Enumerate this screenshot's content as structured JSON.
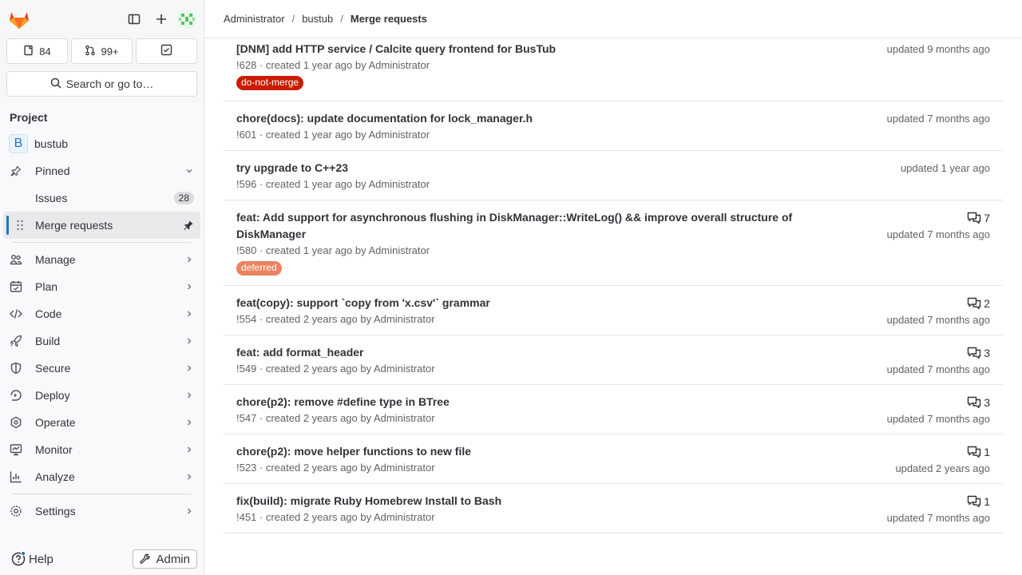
{
  "sidebar": {
    "counters": {
      "issues": "84",
      "merge_requests": "99+"
    },
    "search_label": "Search or go to…",
    "section_title": "Project",
    "project": {
      "initial": "B",
      "name": "bustub"
    },
    "pinned_label": "Pinned",
    "pinned_items": [
      {
        "label": "Issues",
        "count": "28"
      },
      {
        "label": "Merge requests"
      }
    ],
    "menu": [
      {
        "label": "Manage",
        "icon": "users-icon"
      },
      {
        "label": "Plan",
        "icon": "planning-icon"
      },
      {
        "label": "Code",
        "icon": "code-icon"
      },
      {
        "label": "Build",
        "icon": "rocket-icon"
      },
      {
        "label": "Secure",
        "icon": "shield-icon"
      },
      {
        "label": "Deploy",
        "icon": "deployments-icon"
      },
      {
        "label": "Operate",
        "icon": "cloud-gear-icon"
      },
      {
        "label": "Monitor",
        "icon": "monitor-icon"
      },
      {
        "label": "Analyze",
        "icon": "chart-icon"
      }
    ],
    "settings_label": "Settings",
    "help_label": "Help",
    "admin_label": "Admin"
  },
  "breadcrumb": [
    "Administrator",
    "bustub",
    "Merge requests"
  ],
  "merge_requests": [
    {
      "title": "[DNM] add HTTP service / Calcite query frontend for BusTub",
      "meta": "!628 · created 1 year ago by Administrator",
      "updated": "updated 9 months ago",
      "comments": "",
      "label": "do-not-merge",
      "label_color": "#c91c00"
    },
    {
      "title": "chore(docs): update documentation for lock_manager.h",
      "meta": "!601 · created 1 year ago by Administrator",
      "updated": "updated 7 months ago",
      "comments": "",
      "label": "",
      "label_color": ""
    },
    {
      "title": "try upgrade to C++23",
      "meta": "!596 · created 1 year ago by Administrator",
      "updated": "updated 1 year ago",
      "comments": "",
      "label": "",
      "label_color": ""
    },
    {
      "title": "feat: Add support for asynchronous flushing in DiskManager::WriteLog() && improve overall structure of DiskManager",
      "meta": "!580 · created 1 year ago by Administrator",
      "updated": "updated 7 months ago",
      "comments": "7",
      "label": "deferred",
      "label_color": "#e9845f"
    },
    {
      "title": "feat(copy): support `copy from 'x.csv'` grammar",
      "meta": "!554 · created 2 years ago by Administrator",
      "updated": "updated 7 months ago",
      "comments": "2",
      "label": "",
      "label_color": ""
    },
    {
      "title": "feat: add format_header",
      "meta": "!549 · created 2 years ago by Administrator",
      "updated": "updated 7 months ago",
      "comments": "3",
      "label": "",
      "label_color": ""
    },
    {
      "title": "chore(p2): remove #define type in BTree",
      "meta": "!547 · created 2 years ago by Administrator",
      "updated": "updated 7 months ago",
      "comments": "3",
      "label": "",
      "label_color": ""
    },
    {
      "title": "chore(p2): move helper functions to new file",
      "meta": "!523 · created 2 years ago by Administrator",
      "updated": "updated 2 years ago",
      "comments": "1",
      "label": "",
      "label_color": ""
    },
    {
      "title": "fix(build): migrate Ruby Homebrew Install to Bash",
      "meta": "!451 · created 2 years ago by Administrator",
      "updated": "updated 7 months ago",
      "comments": "1",
      "label": "",
      "label_color": ""
    }
  ]
}
